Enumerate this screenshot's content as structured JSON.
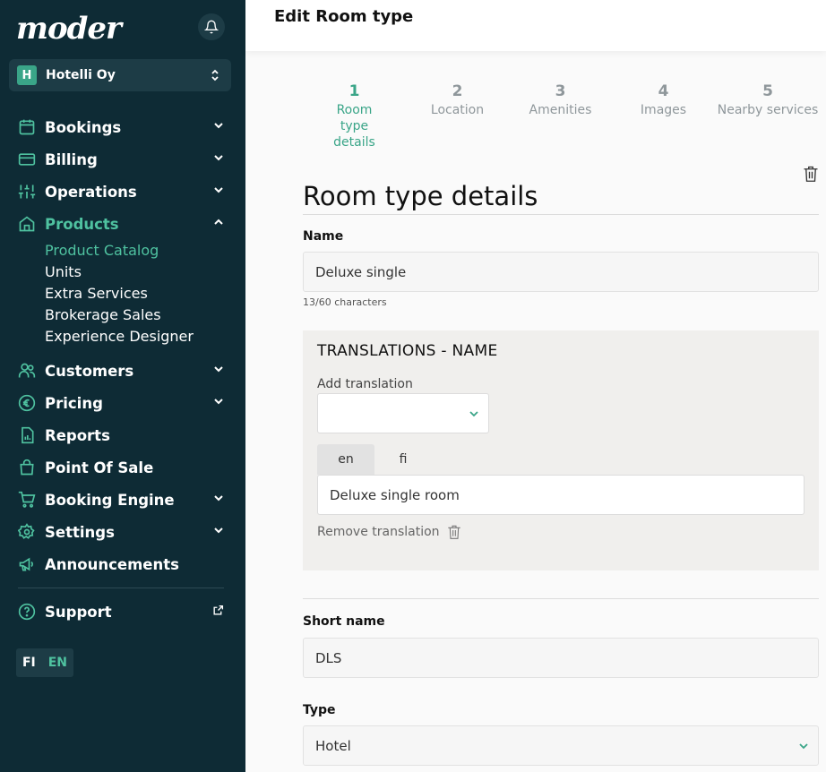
{
  "app": {
    "logo": "moder"
  },
  "org": {
    "badge": "H",
    "name": "Hotelli Oy"
  },
  "nav": {
    "bookings": "Bookings",
    "billing": "Billing",
    "operations": "Operations",
    "products": "Products",
    "products_sub": [
      "Product Catalog",
      "Units",
      "Extra Services",
      "Brokerage Sales",
      "Experience Designer"
    ],
    "customers": "Customers",
    "pricing": "Pricing",
    "reports": "Reports",
    "pos": "Point Of Sale",
    "booking_engine": "Booking Engine",
    "settings": "Settings",
    "announcements": "Announcements",
    "support": "Support"
  },
  "lang": {
    "fi": "FI",
    "en": "EN"
  },
  "page": {
    "title": "Edit Room type"
  },
  "steps": [
    {
      "num": "1",
      "label": "Room type details"
    },
    {
      "num": "2",
      "label": "Location"
    },
    {
      "num": "3",
      "label": "Amenities"
    },
    {
      "num": "4",
      "label": "Images"
    },
    {
      "num": "5",
      "label": "Nearby services"
    }
  ],
  "section": {
    "title": "Room type details"
  },
  "name_field": {
    "label": "Name",
    "value": "Deluxe single",
    "helper": "13/60 characters"
  },
  "translations": {
    "title": "TRANSLATIONS - NAME",
    "add_label": "Add translation",
    "add_value": "",
    "tabs": [
      "en",
      "fi"
    ],
    "active_tab": "en",
    "value": "Deluxe single room",
    "remove_label": "Remove translation"
  },
  "short_name": {
    "label": "Short name",
    "value": "DLS"
  },
  "type_field": {
    "label": "Type",
    "value": "Hotel"
  },
  "colors": {
    "sidebar": "#0e2b35",
    "accent": "#3aa588",
    "accent_light": "#4fc2a0"
  }
}
